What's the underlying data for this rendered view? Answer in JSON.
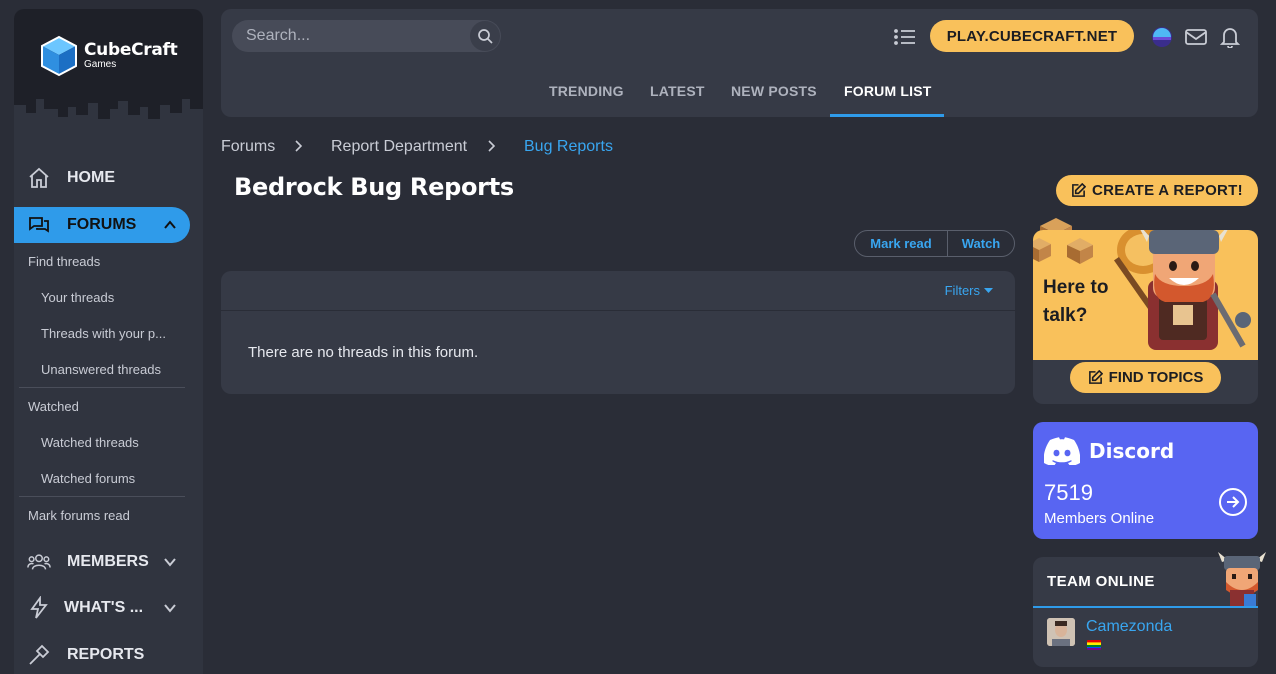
{
  "brand": {
    "name": "CubeCraft",
    "sub": "Games"
  },
  "header": {
    "search_placeholder": "Search...",
    "play_label": "PLAY.CUBECRAFT.NET",
    "tabs": [
      {
        "label": "TRENDING"
      },
      {
        "label": "LATEST"
      },
      {
        "label": "NEW POSTS"
      },
      {
        "label": "FORUM LIST",
        "active": true
      }
    ]
  },
  "sidebar": {
    "home": "HOME",
    "forums": "FORUMS",
    "sub": {
      "find_threads": "Find threads",
      "your_threads": "Your threads",
      "threads_with_posts": "Threads with your p...",
      "unanswered": "Unanswered threads",
      "watched": "Watched",
      "watched_threads": "Watched threads",
      "watched_forums": "Watched forums",
      "mark_read": "Mark forums read"
    },
    "members": "MEMBERS",
    "whats_new": "WHAT'S ...",
    "reports": "REPORTS"
  },
  "breadcrumb": [
    "Forums",
    "Report Department",
    "Bug Reports"
  ],
  "page_title": "Bedrock Bug Reports",
  "actions": {
    "mark_read": "Mark read",
    "watch": "Watch"
  },
  "thread_list": {
    "filters": "Filters",
    "empty_message": "There are no threads in this forum."
  },
  "right": {
    "create_report": "CREATE A REPORT!",
    "talk_text": "Here to talk?",
    "find_topics": "FIND TOPICS",
    "discord": {
      "name": "Discord",
      "count": "7519",
      "label": "Members Online"
    },
    "team": {
      "title": "TEAM ONLINE",
      "members": [
        {
          "name": "Camezonda"
        }
      ]
    }
  },
  "colors": {
    "accent": "#2f9bea",
    "yellow": "#f9c15b",
    "discord": "#5865f2",
    "bg": "#2a2d37",
    "panel": "#363a46"
  }
}
